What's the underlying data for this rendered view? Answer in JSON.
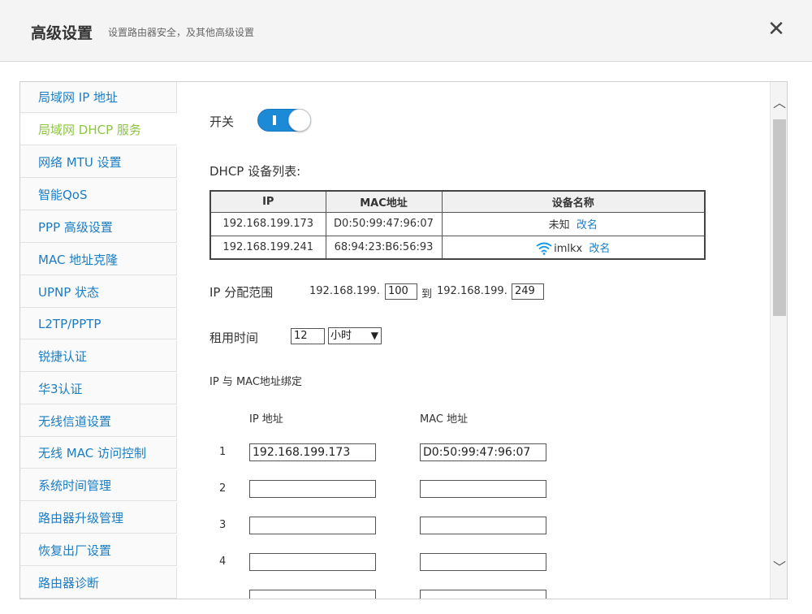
{
  "header": {
    "title": "高级设置",
    "subtitle": "设置路由器安全，及其他高级设置",
    "close_symbol": "✕"
  },
  "sidebar": {
    "items": [
      {
        "label": "局域网 IP 地址",
        "active": false
      },
      {
        "label": "局域网 DHCP 服务",
        "active": true
      },
      {
        "label": "网络 MTU 设置",
        "active": false
      },
      {
        "label": "智能QoS",
        "active": false
      },
      {
        "label": "PPP 高级设置",
        "active": false
      },
      {
        "label": "MAC 地址克隆",
        "active": false
      },
      {
        "label": "UPNP 状态",
        "active": false
      },
      {
        "label": "L2TP/PPTP",
        "active": false
      },
      {
        "label": "锐捷认证",
        "active": false
      },
      {
        "label": "华3认证",
        "active": false
      },
      {
        "label": "无线信道设置",
        "active": false
      },
      {
        "label": "无线 MAC 访问控制",
        "active": false
      },
      {
        "label": "系统时间管理",
        "active": false
      },
      {
        "label": "路由器升级管理",
        "active": false
      },
      {
        "label": "恢复出厂设置",
        "active": false
      },
      {
        "label": "路由器诊断",
        "active": false
      }
    ]
  },
  "dhcp": {
    "switch_label": "开关",
    "switch_on": true,
    "list_title": "DHCP 设备列表:",
    "columns": [
      "IP",
      "MAC地址",
      "设备名称"
    ],
    "rows": [
      {
        "ip": "192.168.199.173",
        "mac": "D0:50:99:47:96:07",
        "name": "未知",
        "rename": "改名",
        "wifi": false
      },
      {
        "ip": "192.168.199.241",
        "mac": "68:94:23:B6:56:93",
        "name": "imlkx",
        "rename": "改名",
        "wifi": true
      }
    ],
    "range_label": "IP 分配范围",
    "range_prefix_start": "192.168.199.",
    "range_start": "100",
    "range_to": "到",
    "range_prefix_end": "192.168.199.",
    "range_end": "249",
    "lease_label": "租用时间",
    "lease_value": "12",
    "lease_unit": "小时",
    "bind_title": "IP 与 MAC地址绑定",
    "bind_col_ip": "IP 地址",
    "bind_col_mac": "MAC 地址",
    "bindings": [
      {
        "num": "1",
        "ip": "192.168.199.173",
        "mac": "D0:50:99:47:96:07"
      },
      {
        "num": "2",
        "ip": "",
        "mac": ""
      },
      {
        "num": "3",
        "ip": "",
        "mac": ""
      },
      {
        "num": "4",
        "ip": "",
        "mac": ""
      }
    ]
  },
  "colors": {
    "link": "#1a7dc4",
    "active": "#8cc63f",
    "toggle": "#1d8ad8"
  }
}
